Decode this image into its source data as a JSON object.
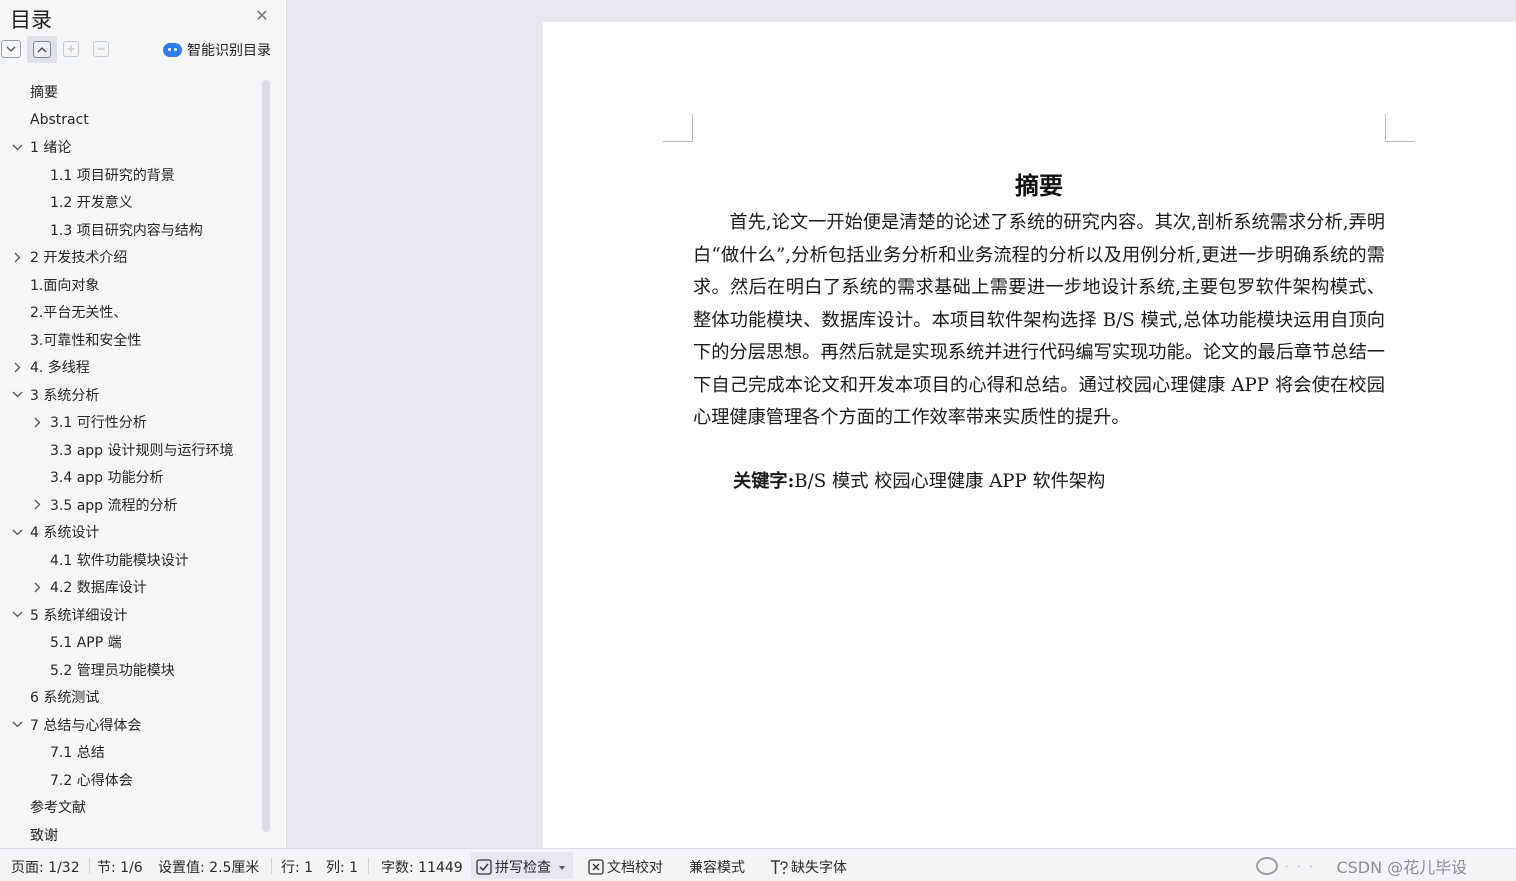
{
  "sidebar": {
    "title": "目录",
    "smart_toc_label": "智能识别目录",
    "items": [
      {
        "label": "摘要",
        "level": 0,
        "chevron": "none"
      },
      {
        "label": "Abstract",
        "level": 0,
        "chevron": "none"
      },
      {
        "label": "1 绪论",
        "level": 0,
        "chevron": "down"
      },
      {
        "label": "1.1 项目研究的背景",
        "level": 1,
        "chevron": "none"
      },
      {
        "label": "1.2 开发意义",
        "level": 1,
        "chevron": "none"
      },
      {
        "label": "1.3 项目研究内容与结构",
        "level": 1,
        "chevron": "none"
      },
      {
        "label": "2 开发技术介绍",
        "level": 0,
        "chevron": "right"
      },
      {
        "label": "1.面向对象",
        "level": 0,
        "chevron": "none"
      },
      {
        "label": "2.平台无关性、",
        "level": 0,
        "chevron": "none"
      },
      {
        "label": "3.可靠性和安全性",
        "level": 0,
        "chevron": "none"
      },
      {
        "label": "4. 多线程",
        "level": 0,
        "chevron": "right"
      },
      {
        "label": "3 系统分析",
        "level": 0,
        "chevron": "down"
      },
      {
        "label": "3.1 可行性分析",
        "level": 1,
        "chevron": "right"
      },
      {
        "label": "3.3 app 设计规则与运行环境",
        "level": 1,
        "chevron": "none"
      },
      {
        "label": "3.4 app 功能分析",
        "level": 1,
        "chevron": "none"
      },
      {
        "label": "3.5 app 流程的分析",
        "level": 1,
        "chevron": "right"
      },
      {
        "label": "4 系统设计",
        "level": 0,
        "chevron": "down"
      },
      {
        "label": "4.1  软件功能模块设计",
        "level": 1,
        "chevron": "none"
      },
      {
        "label": "4.2  数据库设计",
        "level": 1,
        "chevron": "right"
      },
      {
        "label": "5 系统详细设计",
        "level": 0,
        "chevron": "down"
      },
      {
        "label": "5.1 APP 端",
        "level": 1,
        "chevron": "none"
      },
      {
        "label": "5.2 管理员功能模块",
        "level": 1,
        "chevron": "none"
      },
      {
        "label": "6 系统测试",
        "level": 0,
        "chevron": "none"
      },
      {
        "label": "7 总结与心得体会",
        "level": 0,
        "chevron": "down"
      },
      {
        "label": "7.1  总结",
        "level": 1,
        "chevron": "none"
      },
      {
        "label": "7.2  心得体会",
        "level": 1,
        "chevron": "none"
      },
      {
        "label": "参考文献",
        "level": 0,
        "chevron": "none"
      },
      {
        "label": "致谢",
        "level": 0,
        "chevron": "none"
      }
    ]
  },
  "document": {
    "title": "摘要",
    "body": "首先,论文一开始便是清楚的论述了系统的研究内容。其次,剖析系统需求分析,弄明白“做什么”,分析包括业务分析和业务流程的分析以及用例分析,更进一步明确系统的需求。然后在明白了系统的需求基础上需要进一步地设计系统,主要包罗软件架构模式、整体功能模块、数据库设计。本项目软件架构选择 B/S 模式,总体功能模块运用自顶向下的分层思想。再然后就是实现系统并进行代码编写实现功能。论文的最后章节总结一下自己完成本论文和开发本项目的心得和总结。通过校园心理健康 APP 将会使在校园心理健康管理各个方面的工作效率带来实质性的提升。",
    "keywords_label": "关键字:",
    "keywords": "B/S 模式  校园心理健康 APP  软件架构"
  },
  "statusbar": {
    "page": "页面: 1/32",
    "section": "节: 1/6",
    "setting": "设置值: 2.5厘米",
    "row": "行: 1",
    "col": "列: 1",
    "word_count": "字数: 11449",
    "spell_check": "拼写检查",
    "doc_proof": "文档校对",
    "compat_mode": "兼容模式",
    "missing_font": "缺失字体",
    "watermark": "CSDN @花儿毕设"
  }
}
